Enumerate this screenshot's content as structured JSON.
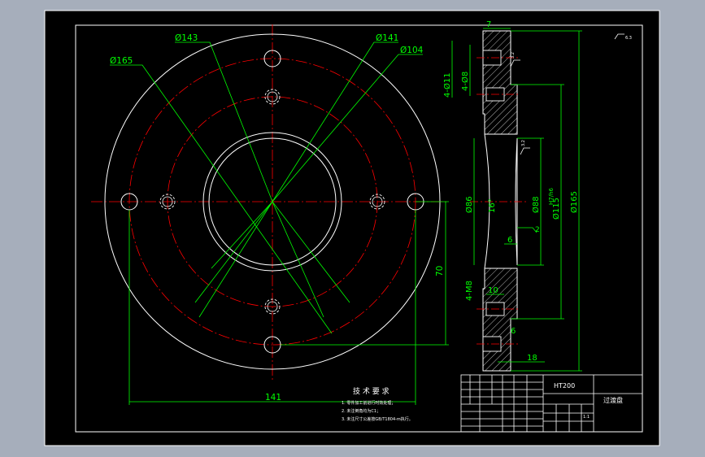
{
  "colors": {
    "app_background": "#a6aebb",
    "sheet": "#000000",
    "outline": "#ffffff",
    "dimension": "#00ff00",
    "centerline": "#ff0000",
    "hatch": "#ffffff",
    "text": "#ffffff"
  },
  "front_view": {
    "diameters": {
      "d165": "Ø165",
      "d143": "Ø143",
      "d141": "Ø141",
      "d104": "Ø104"
    },
    "dim_horizontal": "141",
    "dim_vertical": "70"
  },
  "section_view": {
    "top_thickness": "7",
    "hole_small_1": "4-Ø11",
    "hole_small_2": "4-Ø8",
    "thread": "4-M8",
    "angle": "16°",
    "d86": "Ø86",
    "d88": "Ø88",
    "d115": "Ø115",
    "d115_tol": "H7/h6",
    "d165": "Ø165",
    "dim_6a": "6",
    "dim_2": "2",
    "dim_10": "10",
    "dim_6b": "6",
    "dim_18": "18",
    "roughness_a": "3.2",
    "roughness_b": "3.2",
    "roughness_general": "6.3"
  },
  "notes": {
    "title": "技 术 要 求",
    "line1": "1. 零件加工前进行时效处理；",
    "line2": "2. 未注倒角均为C1；",
    "line3": "3. 未注尺寸公差按GB/T1804-m执行。"
  },
  "title_block": {
    "material": "HT200",
    "part_name": "过渡盘",
    "scale": "1:1"
  }
}
